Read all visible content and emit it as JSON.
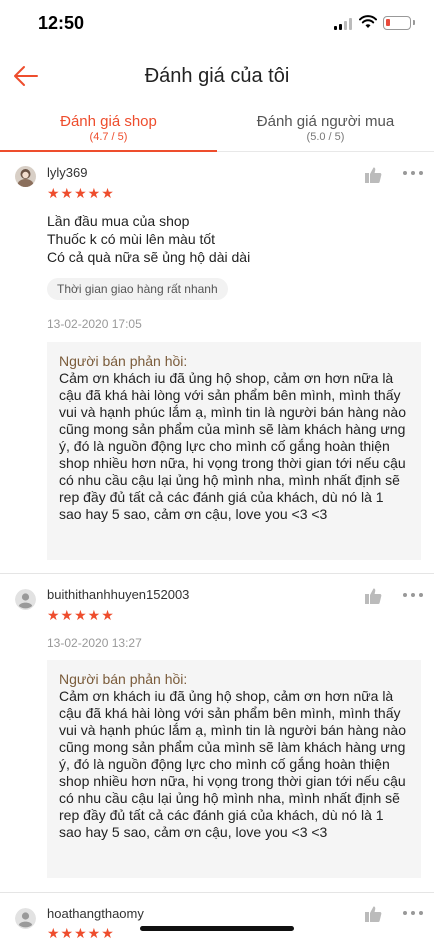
{
  "status_bar": {
    "time": "12:50"
  },
  "header": {
    "title": "Đánh giá của tôi"
  },
  "tabs": [
    {
      "label": "Đánh giá shop",
      "sub": "(4.7 / 5)",
      "active": true
    },
    {
      "label": "Đánh giá người mua",
      "sub": "(5.0 / 5)",
      "active": false
    }
  ],
  "reviews": [
    {
      "username": "lyly369",
      "rating": 5,
      "stars": "★★★★★",
      "comment": "Lần đầu mua của shop\nThuốc k có mùi lên màu tốt\nCó cả quà nữa sẽ ủng hộ dài dài",
      "tag": "Thời gian giao hàng rất nhanh",
      "date": "13-02-2020 17:05",
      "reply_title": "Người bán phản hồi:",
      "reply_text": "Cảm ơn khách iu đã ủng hộ shop, cảm ơn hơn nữa là cậu đã khá hài lòng với sản phẩm bên mình, mình thấy vui và hạnh phúc lắm ạ, mình tin là người bán hàng nào cũng mong sản phẩm của mình sẽ làm khách hàng ưng ý, đó là nguồn động lực cho mình cố gắng hoàn thiện shop nhiều hơn nữa, hi vọng trong thời gian tới nếu cậu có nhu cầu cậu lại ủng hộ mình nha, mình nhất định sẽ rep đầy đủ tất cả các đánh giá của khách, dù nó là 1 sao hay 5 sao, cảm ơn cậu, love you <3 <3"
    },
    {
      "username": "buithithanhhuyen152003",
      "rating": 5,
      "stars": "★★★★★",
      "date": "13-02-2020 13:27",
      "reply_title": "Người bán phản hồi:",
      "reply_text": "Cảm ơn khách iu đã ủng hộ shop, cảm ơn hơn nữa là cậu đã khá hài lòng với sản phẩm bên mình, mình thấy vui và hạnh phúc lắm ạ, mình tin là người bán hàng nào cũng mong sản phẩm của mình sẽ làm khách hàng ưng ý, đó là nguồn động lực cho mình cố gắng hoàn thiện shop nhiều hơn nữa, hi vọng trong thời gian tới nếu cậu có nhu cầu cậu lại ủng hộ mình nha, mình nhất định sẽ rep đầy đủ tất cả các đánh giá của khách, dù nó là 1 sao hay 5 sao, cảm ơn cậu, love you <3 <3"
    },
    {
      "username": "hoathangthaomy",
      "rating": 5,
      "stars": "★★★★★"
    }
  ],
  "colors": {
    "accent": "#ee4d2d",
    "reply_title": "#7a5b3a",
    "reply_bg": "#f5f5f5"
  }
}
